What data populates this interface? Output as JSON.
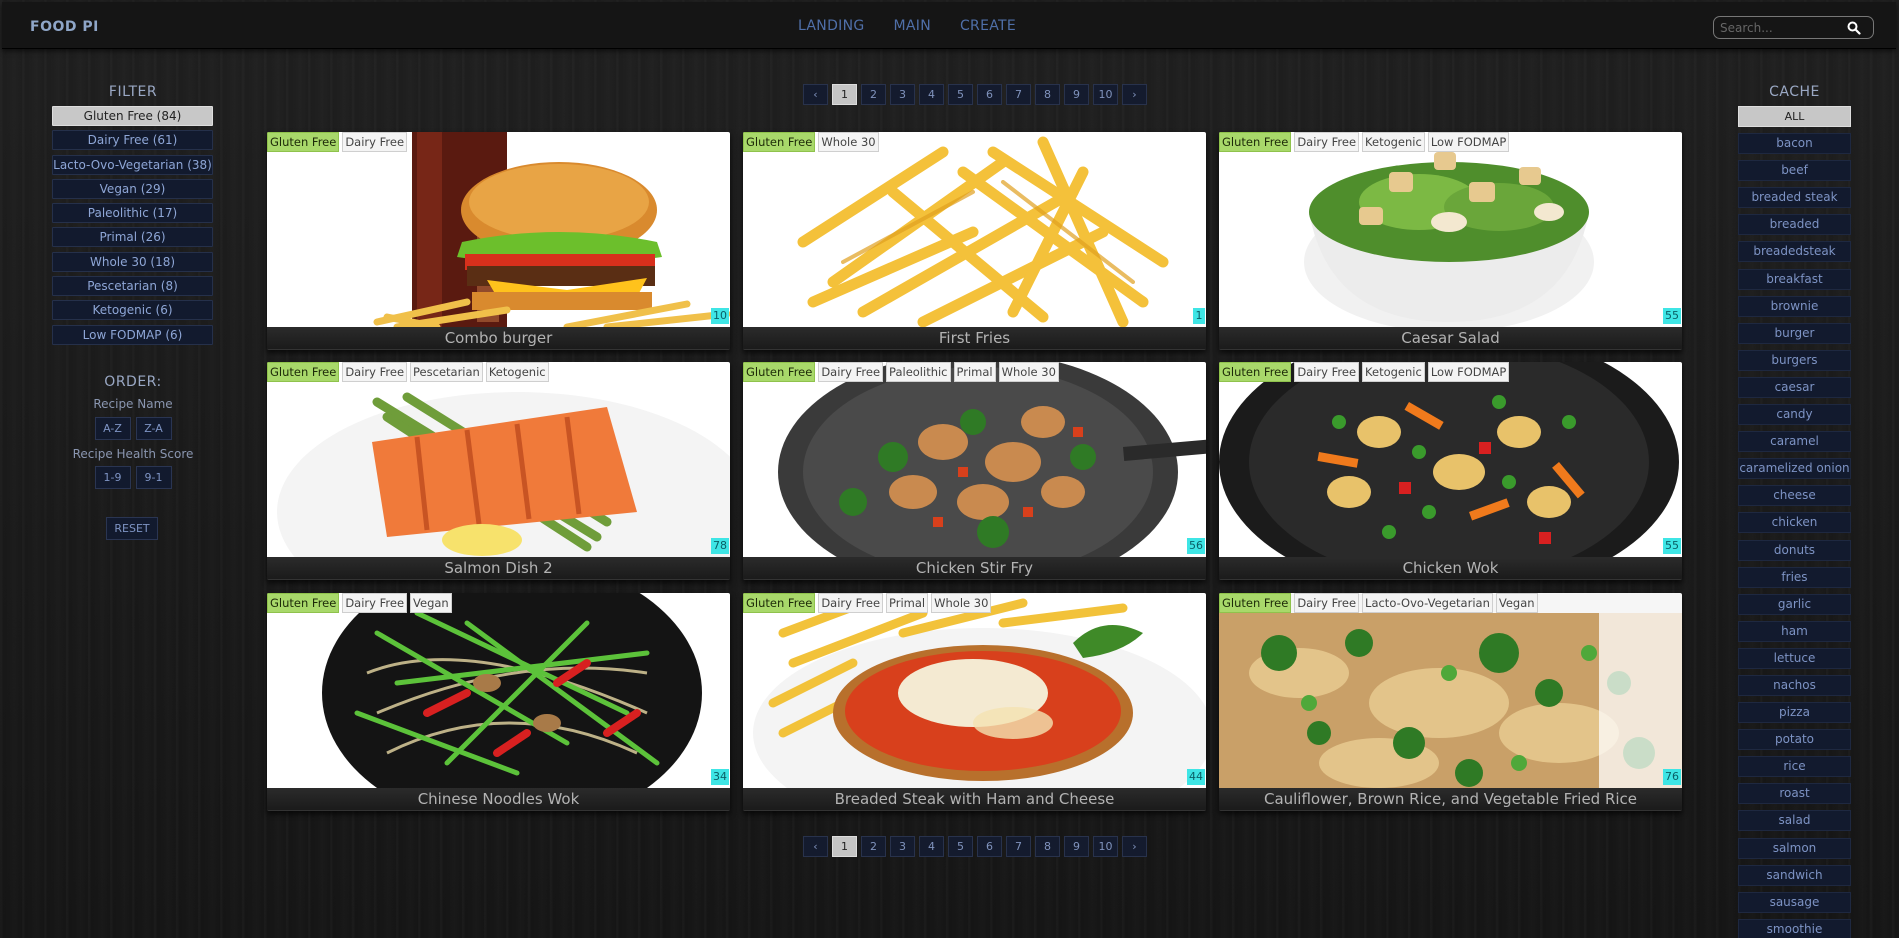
{
  "nav": {
    "brand": "FOOD PI",
    "links": [
      "LANDING",
      "MAIN",
      "CREATE"
    ],
    "search_placeholder": "Search..."
  },
  "filter": {
    "title": "FILTER",
    "items": [
      "Gluten Free (84)",
      "Dairy Free (61)",
      "Lacto-Ovo-Vegetarian (38)",
      "Vegan (29)",
      "Paleolithic (17)",
      "Primal (26)",
      "Whole 30 (18)",
      "Pescetarian (8)",
      "Ketogenic (6)",
      "Low FODMAP (6)"
    ],
    "active_index": 0
  },
  "order": {
    "title": "ORDER:",
    "name_label": "Recipe Name",
    "name_options": [
      "A-Z",
      "Z-A"
    ],
    "score_label": "Recipe Health Score",
    "score_options": [
      "1-9",
      "9-1"
    ],
    "reset": "RESET"
  },
  "pagination": {
    "prev": "‹",
    "next": "›",
    "pages": [
      "1",
      "2",
      "3",
      "4",
      "5",
      "6",
      "7",
      "8",
      "9",
      "10"
    ],
    "active": "1"
  },
  "recipes": [
    {
      "title": "Combo burger",
      "tags": [
        "Gluten Free",
        "Dairy Free"
      ],
      "score": "10",
      "image": "burger"
    },
    {
      "title": "First Fries",
      "tags": [
        "Gluten Free",
        "Whole 30"
      ],
      "score": "1",
      "image": "fries"
    },
    {
      "title": "Caesar Salad",
      "tags": [
        "Gluten Free",
        "Dairy Free",
        "Ketogenic",
        "Low FODMAP"
      ],
      "score": "55",
      "image": "salad"
    },
    {
      "title": "Salmon Dish 2",
      "tags": [
        "Gluten Free",
        "Dairy Free",
        "Pescetarian",
        "Ketogenic"
      ],
      "score": "78",
      "image": "salmon"
    },
    {
      "title": "Chicken Stir Fry",
      "tags": [
        "Gluten Free",
        "Dairy Free",
        "Paleolithic",
        "Primal",
        "Whole 30"
      ],
      "score": "56",
      "image": "stirfry"
    },
    {
      "title": "Chicken Wok",
      "tags": [
        "Gluten Free",
        "Dairy Free",
        "Ketogenic",
        "Low FODMAP"
      ],
      "score": "55",
      "image": "wok"
    },
    {
      "title": "Chinese Noodles Wok",
      "tags": [
        "Gluten Free",
        "Dairy Free",
        "Vegan"
      ],
      "score": "34",
      "image": "noodles"
    },
    {
      "title": "Breaded Steak with Ham and Cheese",
      "tags": [
        "Gluten Free",
        "Dairy Free",
        "Primal",
        "Whole 30"
      ],
      "score": "44",
      "image": "steak"
    },
    {
      "title": "Cauliflower, Brown Rice, and Vegetable Fried Rice",
      "tags": [
        "Gluten Free",
        "Dairy Free",
        "Lacto-Ovo-Vegetarian",
        "Vegan"
      ],
      "score": "76",
      "image": "rice"
    }
  ],
  "cache": {
    "title": "CACHE",
    "items": [
      "ALL",
      "bacon",
      "beef",
      "breaded steak",
      "breaded",
      "breadedsteak",
      "breakfast",
      "brownie",
      "burger",
      "burgers",
      "caesar",
      "candy",
      "caramel",
      "caramelized onion",
      "cheese",
      "chicken",
      "donuts",
      "fries",
      "garlic",
      "ham",
      "lettuce",
      "nachos",
      "pizza",
      "potato",
      "rice",
      "roast",
      "salad",
      "salmon",
      "sandwich",
      "sausage",
      "smoothie"
    ],
    "active_index": 0
  }
}
